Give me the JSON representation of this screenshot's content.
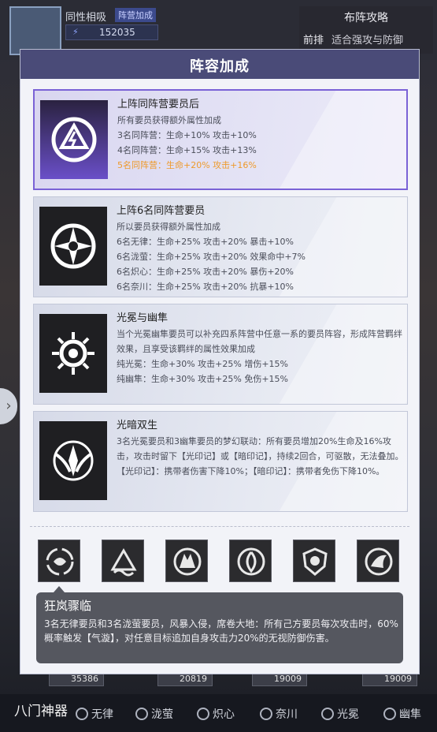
{
  "player": {
    "name": "同性相吸",
    "badge": "阵营加成",
    "power": "152035"
  },
  "strategy": {
    "title": "布阵攻略",
    "row_label": "前排",
    "row_text": "适合强攻与防御"
  },
  "modal": {
    "title": "阵容加成"
  },
  "cards": [
    {
      "title": "上阵同阵营要员后",
      "icon": "faction-emblem-icon",
      "lines": [
        {
          "text": "所有要员获得额外属性加成",
          "highlight": false
        },
        {
          "text": "3名同阵营：生命+10% 攻击+10%",
          "highlight": false
        },
        {
          "text": "4名同阵营：生命+15% 攻击+13%",
          "highlight": false
        },
        {
          "text": "5名同阵营：生命+20% 攻击+16%",
          "highlight": true
        }
      ]
    },
    {
      "title": "上阵6名同阵营要员",
      "icon": "compass-emblem-icon",
      "lines": [
        {
          "text": "所以要员获得额外属性加成",
          "highlight": false
        },
        {
          "text": "6名无律：生命+25% 攻击+20% 暴击+10%",
          "highlight": false
        },
        {
          "text": "6名泷萤：生命+25% 攻击+20% 效果命中+7%",
          "highlight": false
        },
        {
          "text": "6名炽心：生命+25% 攻击+20% 暴伤+20%",
          "highlight": false
        },
        {
          "text": "6名奈川：生命+25% 攻击+20% 抗暴+10%",
          "highlight": false
        }
      ]
    },
    {
      "title": "光冕与幽隼",
      "icon": "radiant-emblem-icon",
      "paragraph": "当个光冕幽隼要员可以补充四系阵营中任意一系的要员阵容，形成阵营羁绊效果，且享受该羁绊的属性效果加成",
      "lines": [
        {
          "text": "纯光冕：生命+30% 攻击+25% 增伤+15%",
          "highlight": false
        },
        {
          "text": "纯幽隼：生命+30% 攻击+25% 免伤+15%",
          "highlight": false
        }
      ]
    },
    {
      "title": "光暗双生",
      "icon": "dual-wing-emblem-icon",
      "paragraph": "3名光冕要员和3幽隼要员的梦幻联动：所有要员增加20%生命及16%攻击，攻击时留下【光印记】或【暗印记】，持续2回合，可驱散，无法叠加。【光印记】：携带者伤害下降10%；【暗印记】：携带者免伤下降10%。"
    }
  ],
  "skills": [
    {
      "name": "storm-skill-icon"
    },
    {
      "name": "wave-skill-icon"
    },
    {
      "name": "wolf-skill-icon"
    },
    {
      "name": "flame-skill-icon"
    },
    {
      "name": "shield-skill-icon"
    },
    {
      "name": "wing-skill-icon"
    }
  ],
  "selected_skill": {
    "title": "狂岚骤临",
    "description": "3名无律要员和3名泷萤要员，风暴入侵，席卷大地：所有己方要员每次攻击时，60%概率触发【气漩】，对任意目标追加自身攻击力20%的无视防御伤害。"
  },
  "background_strip": {
    "values": [
      "35386",
      "20819",
      "19009",
      "19009"
    ]
  },
  "bottom": {
    "title": "八门神器",
    "factions": [
      "无律",
      "泷萤",
      "炽心",
      "奈川",
      "光冕",
      "幽隼"
    ]
  },
  "colors": {
    "accent": "#7a62d6",
    "highlight": "#ee9a2c",
    "header": "#4a4b78"
  }
}
